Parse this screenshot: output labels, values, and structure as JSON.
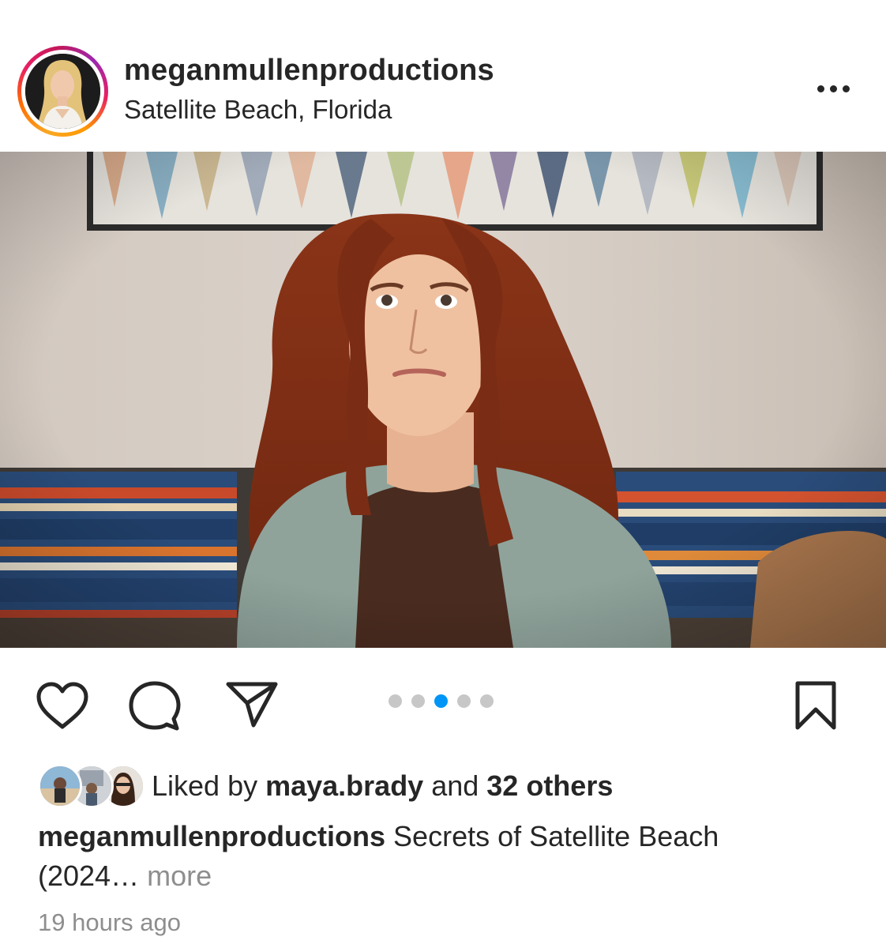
{
  "header": {
    "username": "meganmullenproductions",
    "location": "Satellite Beach, Florida"
  },
  "carousel": {
    "total": 5,
    "active_index": 2,
    "active_color": "#0095f6"
  },
  "likes": {
    "prefix": "Liked by ",
    "first_liker": "maya.brady",
    "middle": " and ",
    "others": "32 others"
  },
  "caption": {
    "username": "meganmullenproductions",
    "text_line1": " Secrets of Satellite Beach",
    "text_line2": "(2024…",
    "more_label": " more"
  },
  "timestamp": "19 hours ago",
  "icons": [
    "heart-icon",
    "comment-icon",
    "share-icon",
    "bookmark-icon",
    "more-icon"
  ],
  "colors": {
    "story_ring": "#e91e63",
    "meta": "#8e8e8e",
    "text": "#262626"
  }
}
